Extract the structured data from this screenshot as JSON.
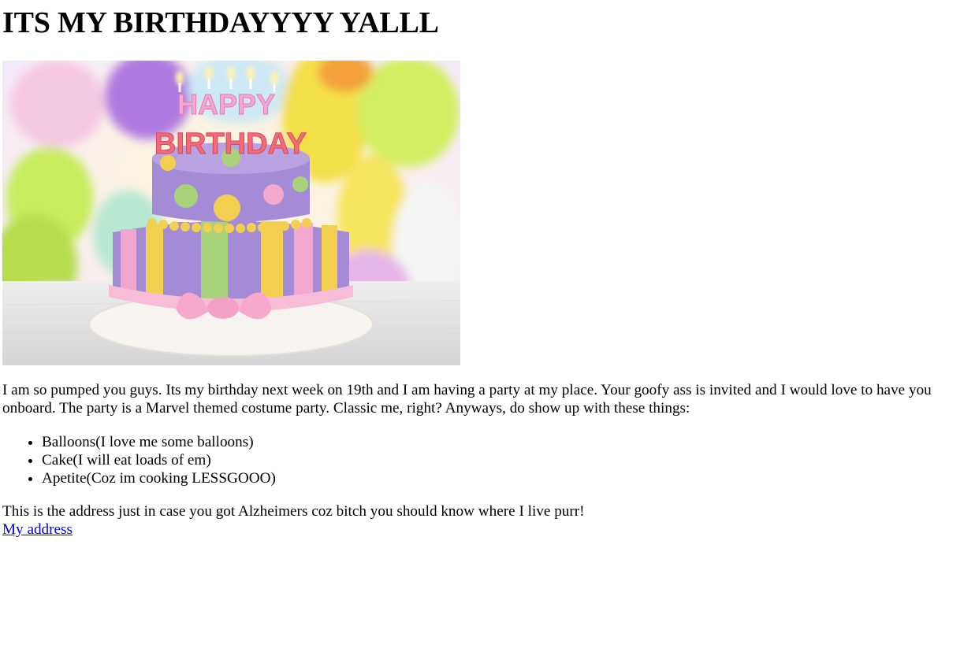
{
  "page": {
    "heading": "ITS MY BIRTHDAYYYY YALLL",
    "image": {
      "cake_text_line1": "HAPPY",
      "cake_text_line2": "BIRTHDAY"
    },
    "intro": "I am so pumped you guys. Its my birthday next week on 19th and I am having a party at my place. Your goofy ass is invited and I would love to have you onboard. The party is a Marvel themed costume party. Classic me, right? Anyways, do show up with these things:",
    "items": [
      "Balloons(I love me some balloons)",
      "Cake(I will eat loads of em)",
      "Apetite(Coz im cooking LESSGOOO)"
    ],
    "address_note": "This is the address just in case you got Alzheimers coz bitch you should know where I live purr!",
    "address_link": "My address",
    "colors": {
      "link": "#0000ee",
      "cake_purple": "#a58bd6",
      "cake_pink": "#f3a9cf",
      "cake_yellow": "#f2cf4f",
      "cake_green": "#a9d37a"
    }
  }
}
